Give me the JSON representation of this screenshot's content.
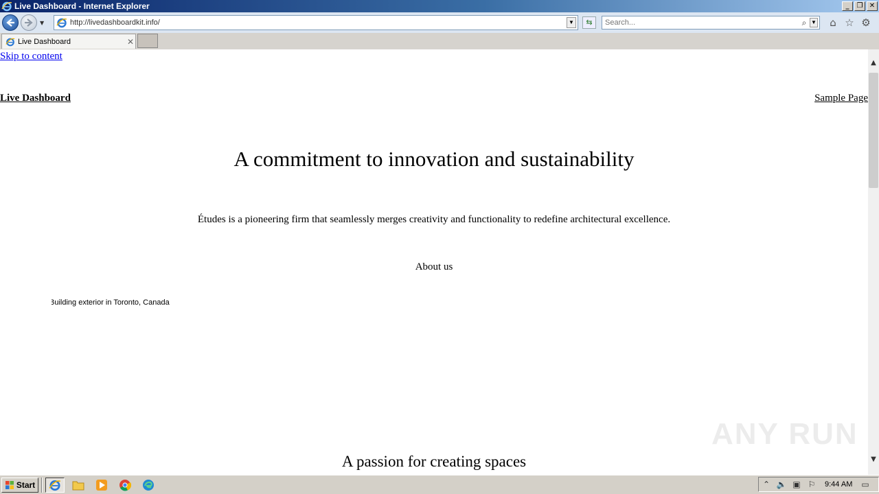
{
  "window": {
    "title": "Live Dashboard - Internet Explorer",
    "controls": [
      "minimize",
      "restore",
      "close"
    ]
  },
  "nav": {
    "address": "http://livedashboardkit.info/",
    "search_placeholder": "Search..."
  },
  "tabs": [
    {
      "label": "Live Dashboard",
      "active": true
    }
  ],
  "page": {
    "skip_link": "Skip to content",
    "site_title": "Live Dashboard",
    "nav_link": "Sample Page",
    "hero_heading": "A commitment to innovation and sustainability",
    "hero_text": "Études is a pioneering firm that seamlessly merges creativity and functionality to redefine architectural excellence.",
    "about_link": "About us",
    "image_alt": "Building exterior in Toronto, Canada",
    "section_heading": "A passion for creating spaces"
  },
  "watermark": "ANY RUN",
  "taskbar": {
    "start_label": "Start",
    "apps": [
      "internet-explorer",
      "file-explorer",
      "media-player",
      "chrome",
      "edge"
    ],
    "clock": "9:44 AM"
  },
  "colors": {
    "link": "#0000ee",
    "titlebar_start": "#0a246a",
    "taskbar": "#d4d0c8"
  }
}
